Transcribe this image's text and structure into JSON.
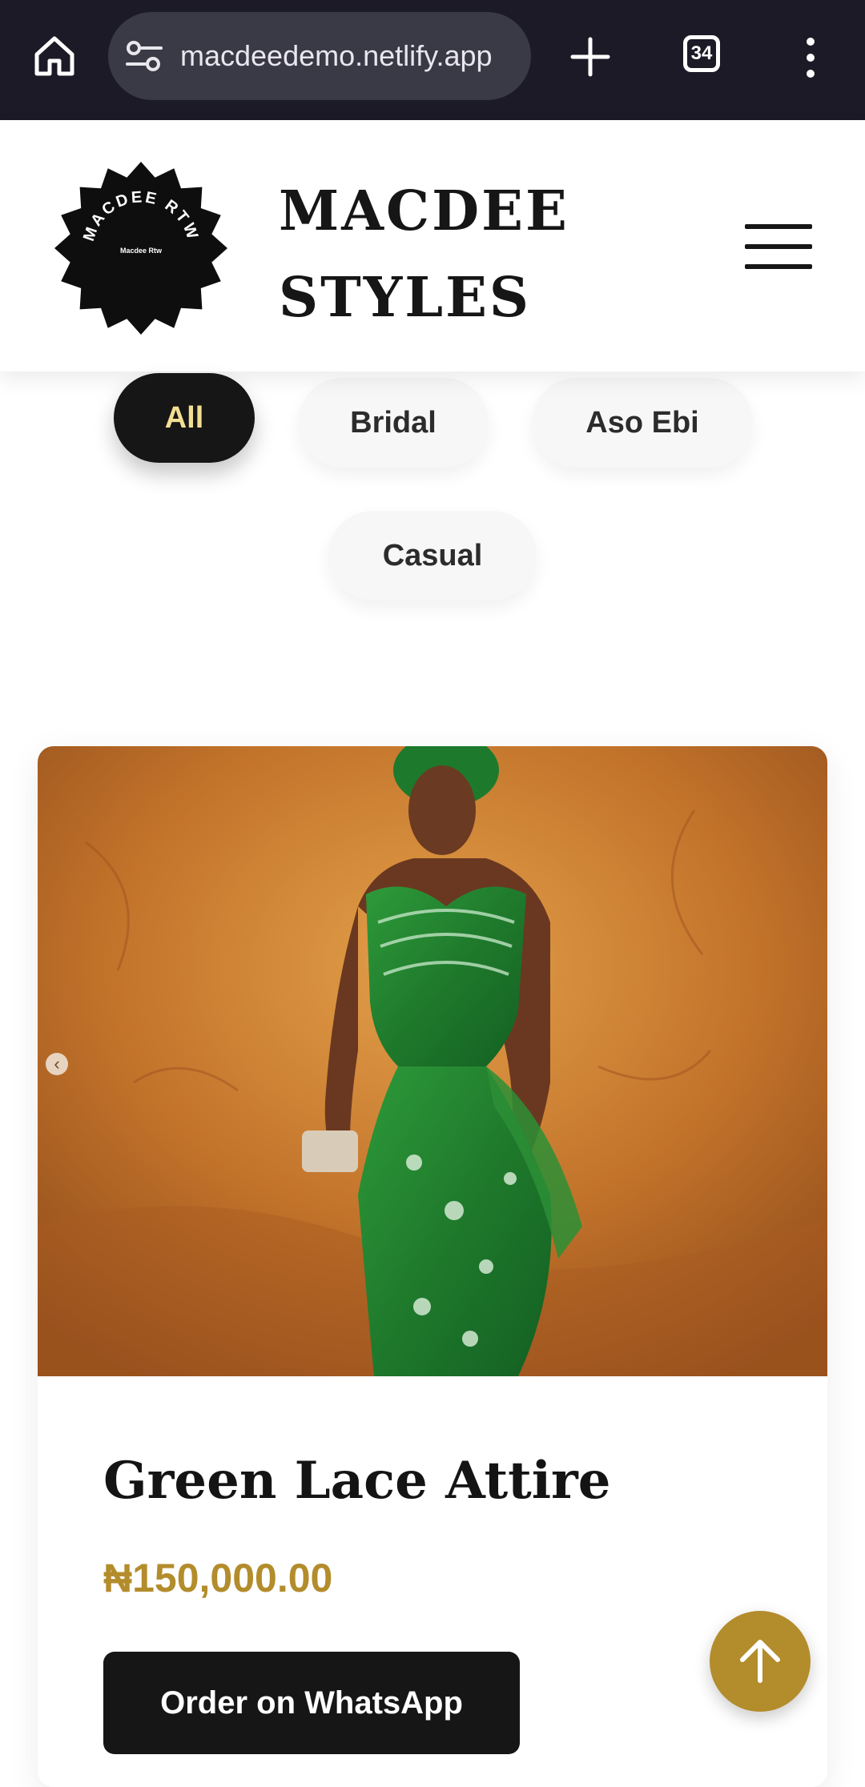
{
  "browser": {
    "url": "macdeedemo.netlify.app",
    "tab_count": "34",
    "icons": [
      "home-icon",
      "site-settings-icon",
      "new-tab-plus-icon",
      "tab-switcher-icon",
      "more-options-icon"
    ]
  },
  "header": {
    "logo_ring_text": "MACDEE RTW",
    "logo_center_text": "Macdee Rtw",
    "brand_line1": "MACDEE",
    "brand_line2": "STYLES",
    "menu_icon": "hamburger-menu-icon"
  },
  "filters": [
    {
      "label": "All",
      "active": true
    },
    {
      "label": "Bridal",
      "active": false
    },
    {
      "label": "Aso Ebi",
      "active": false
    },
    {
      "label": "Casual",
      "active": false
    }
  ],
  "product": {
    "title": "Green Lace Attire",
    "price": "₦150,000.00",
    "order_label": "Order on WhatsApp",
    "prev_icon": "chevron-left-icon"
  },
  "fab_icon": "arrow-up-icon",
  "colors": {
    "chrome_bg": "#1b1a26",
    "accent_gold": "#b38c2c",
    "active_pill_text": "#f3df92",
    "dark": "#161616"
  }
}
